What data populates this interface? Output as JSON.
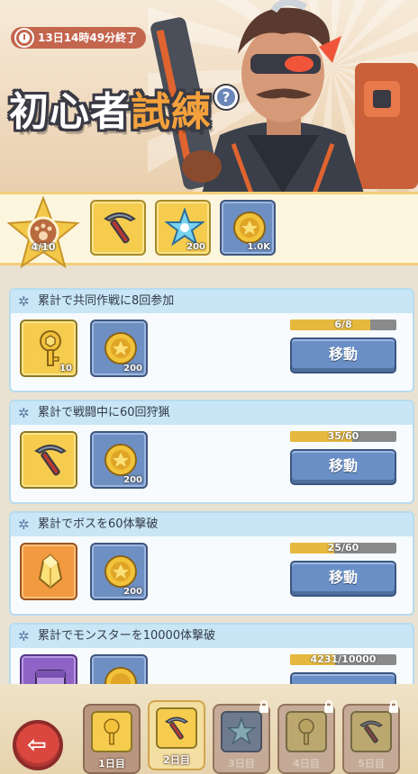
{
  "header": {
    "timer": "13日14時49分終了",
    "title_part1": "初心者",
    "title_part2": "試練",
    "help": "?"
  },
  "rewards_strip": {
    "star_progress": "4/10",
    "items": [
      {
        "icon": "pickaxe-icon",
        "qty": ""
      },
      {
        "icon": "crystal-flower-icon",
        "qty": "200"
      },
      {
        "icon": "gold-coin-icon",
        "qty": "1.0K"
      }
    ]
  },
  "quests": [
    {
      "title": "累計で共同作戦に8回参加",
      "rewards": [
        {
          "icon": "key-icon",
          "qty": "10",
          "color": "gold"
        },
        {
          "icon": "gold-coin-icon",
          "qty": "200",
          "color": "blue"
        }
      ],
      "progress_text": "6/8",
      "progress": 0.75,
      "button": "移動"
    },
    {
      "title": "累計で戦闘中に60回狩猟",
      "rewards": [
        {
          "icon": "pickaxe-icon",
          "qty": "",
          "color": "gold"
        },
        {
          "icon": "gold-coin-icon",
          "qty": "200",
          "color": "blue"
        }
      ],
      "progress_text": "35/60",
      "progress": 0.583,
      "button": "移動"
    },
    {
      "title": "累計でボスを60体撃破",
      "rewards": [
        {
          "icon": "crystal-icon",
          "qty": "",
          "color": "orange"
        },
        {
          "icon": "gold-coin-icon",
          "qty": "200",
          "color": "blue"
        }
      ],
      "progress_text": "25/60",
      "progress": 0.417,
      "button": "移動"
    },
    {
      "title": "累計でモンスターを10000体撃破",
      "rewards": [
        {
          "icon": "chest-icon",
          "qty": "",
          "color": "purple"
        },
        {
          "icon": "gold-coin-icon",
          "qty": "",
          "color": "blue"
        }
      ],
      "progress_text": "4231/10000",
      "progress": 0.4231,
      "button": ""
    }
  ],
  "days": [
    {
      "label": "1日目",
      "icon": "key-icon",
      "locked": false,
      "active": false
    },
    {
      "label": "2日目",
      "icon": "pickaxe-icon",
      "locked": false,
      "active": true
    },
    {
      "label": "3日目",
      "icon": "crystal-flower-icon",
      "locked": true,
      "active": false
    },
    {
      "label": "4日目",
      "icon": "key-icon",
      "locked": true,
      "active": false
    },
    {
      "label": "5日目",
      "icon": "pickaxe-icon",
      "locked": true,
      "active": false
    }
  ],
  "colors": {
    "accent_title": "#f4a13c",
    "button_blue": "#6a8fc6",
    "progress_fill": "#e6b83e",
    "card_header": "#c8e6f6"
  }
}
